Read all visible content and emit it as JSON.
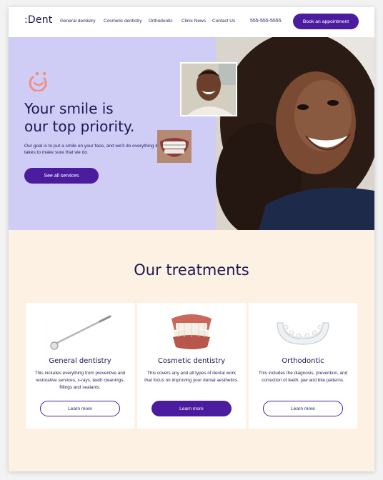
{
  "header": {
    "logo": ":Dent",
    "nav": [
      "General dentistry",
      "Cosmetic dentistry",
      "Orthodontic",
      "Clinic News",
      "Contact Us"
    ],
    "phone": "555-555-5555",
    "book_label": "Book an appointment"
  },
  "hero": {
    "title_line1": "Your smile is",
    "title_line2": "our top priority.",
    "text": "Our goal is to put a smile on your face, and we'll do everything it takes to make sure that we do.",
    "button_label": "See all services"
  },
  "treatments": {
    "title": "Our treatments",
    "cards": [
      {
        "title": "General dentistry",
        "text": "This includes everything from preventive and restorative services, x-rays, teeth cleanings, fillings and sealants.",
        "button": "Learn more"
      },
      {
        "title": "Cosmetic dentistry",
        "text": "This covers any and all types of dental work that focus on improving your dental aesthetics.",
        "button": "Learn more"
      },
      {
        "title": "Orthodontic",
        "text": "This includes the diagnosis, prevention, and correction of teeth, jaw and bite patterns.",
        "button": "Learn more"
      }
    ]
  },
  "colors": {
    "accent": "#4b1d9e",
    "hero_bg": "#cfcdf6",
    "section_bg": "#fdf1e3",
    "text_dark": "#1c1752",
    "icon_coral": "#f08f7e"
  },
  "icons": [
    "smile-logo-icon",
    "dental-mirror-icon",
    "dentures-icon",
    "clear-aligner-icon"
  ]
}
